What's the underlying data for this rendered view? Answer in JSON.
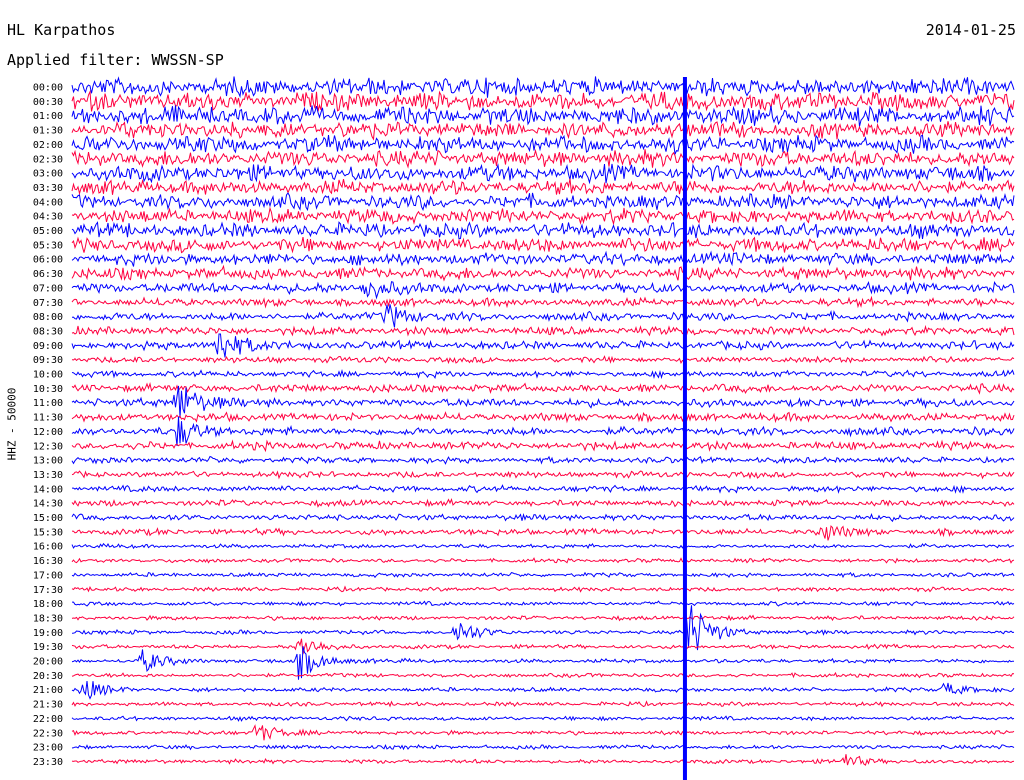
{
  "header": {
    "station": "HL Karpathos",
    "date": "2014-01-25",
    "filter": "Applied filter: WWSSN-SP"
  },
  "chart_data": {
    "type": "line",
    "title": "HL Karpathos",
    "ylabel": "HHZ - 50000",
    "rows": [
      "00:00",
      "00:30",
      "01:00",
      "01:30",
      "02:00",
      "02:30",
      "03:00",
      "03:30",
      "04:00",
      "04:30",
      "05:00",
      "05:30",
      "06:00",
      "06:30",
      "07:00",
      "07:30",
      "08:00",
      "08:30",
      "09:00",
      "09:30",
      "10:00",
      "10:30",
      "11:00",
      "11:30",
      "12:00",
      "12:30",
      "13:00",
      "13:30",
      "14:00",
      "14:30",
      "15:00",
      "15:30",
      "16:00",
      "16:30",
      "17:00",
      "17:30",
      "18:00",
      "18:30",
      "19:00",
      "19:30",
      "20:00",
      "20:30",
      "21:00",
      "21:30",
      "22:00",
      "22:30",
      "23:00",
      "23:30"
    ],
    "trace_colors": [
      "#0000ff",
      "#ff0040"
    ],
    "x_minutes_per_row": 30,
    "noise_level": [
      9,
      9,
      9,
      8,
      8,
      8,
      8,
      7,
      7,
      7,
      7,
      7,
      6,
      6,
      5,
      4,
      4,
      4,
      4,
      3,
      3,
      4,
      4,
      4,
      4,
      4,
      3,
      3,
      3,
      3,
      3,
      3,
      2,
      2,
      2,
      2,
      2,
      2,
      2,
      2,
      2,
      2,
      2,
      2,
      2,
      2,
      2,
      2
    ],
    "events": [
      {
        "row": 18,
        "minute": 4.6,
        "amplitude": 22
      },
      {
        "row": 14,
        "minute": 9.3,
        "amplitude": 14
      },
      {
        "row": 16,
        "minute": 10.0,
        "amplitude": 14
      },
      {
        "row": 22,
        "minute": 3.3,
        "amplitude": 26
      },
      {
        "row": 24,
        "minute": 3.3,
        "amplitude": 16
      },
      {
        "row": 38,
        "minute": 12.2,
        "amplitude": 14
      },
      {
        "row": 40,
        "minute": 7.2,
        "amplitude": 18
      },
      {
        "row": 39,
        "minute": 7.2,
        "amplitude": 12
      },
      {
        "row": 40,
        "minute": 2.2,
        "amplitude": 12
      },
      {
        "row": 42,
        "minute": 0.3,
        "amplitude": 12
      },
      {
        "row": 42,
        "minute": 27.7,
        "amplitude": 8
      },
      {
        "row": 31,
        "minute": 23.8,
        "amplitude": 10
      },
      {
        "row": 45,
        "minute": 5.8,
        "amplitude": 12
      },
      {
        "row": 47,
        "minute": 24.5,
        "amplitude": 8
      },
      {
        "row": 38,
        "minute": 19.5,
        "amplitude": 40
      }
    ]
  }
}
